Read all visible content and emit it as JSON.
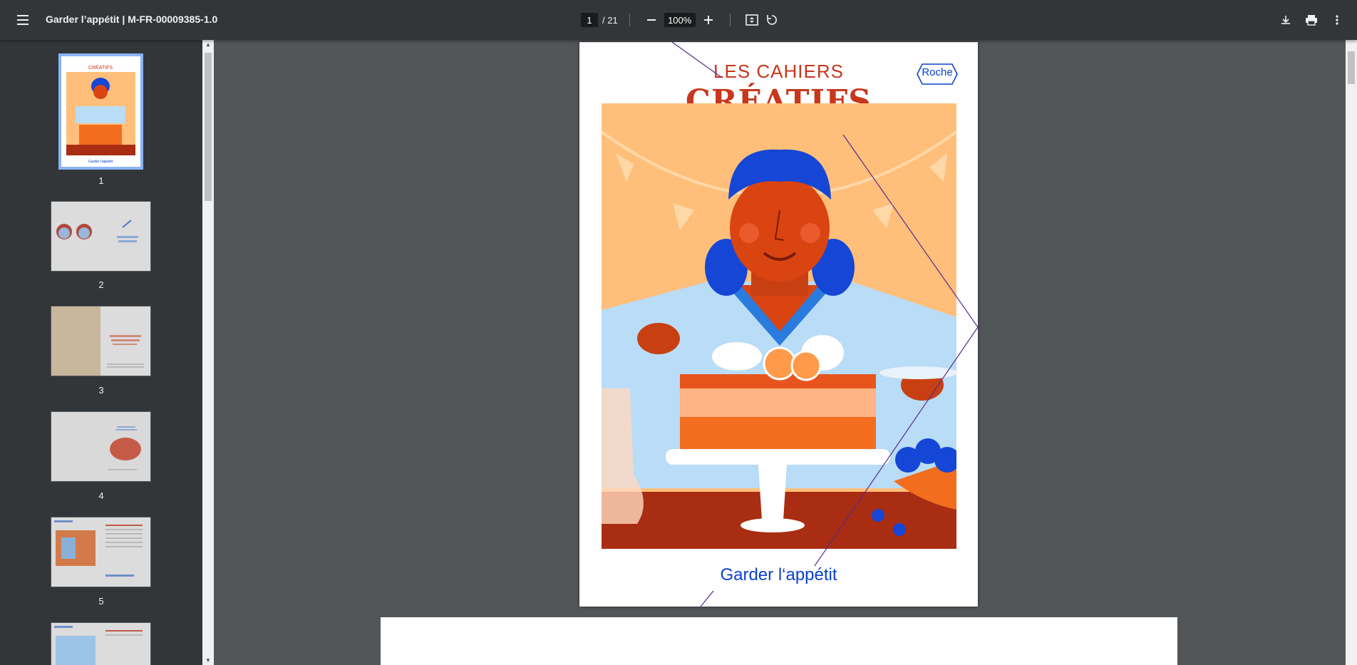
{
  "toolbar": {
    "title": "Garder l’appétit | M-FR-00009385-1.0",
    "page_current": "1",
    "page_total": "/ 21",
    "zoom": "100%"
  },
  "sidebar": {
    "thumbnails": [
      {
        "label": "1"
      },
      {
        "label": "2"
      },
      {
        "label": "3"
      },
      {
        "label": "4"
      },
      {
        "label": "5"
      }
    ]
  },
  "document": {
    "brand_small": "LES CAHIERS",
    "brand_big": "CRÉATIFS",
    "logo": "Roche",
    "subtitle": "Garder l‘appétit"
  },
  "colors": {
    "toolbar": "#323639",
    "viewer_bg": "#525659",
    "accent_red": "#c8361b",
    "accent_blue": "#0b41cd",
    "illus_bg": "#ffbf7a"
  }
}
